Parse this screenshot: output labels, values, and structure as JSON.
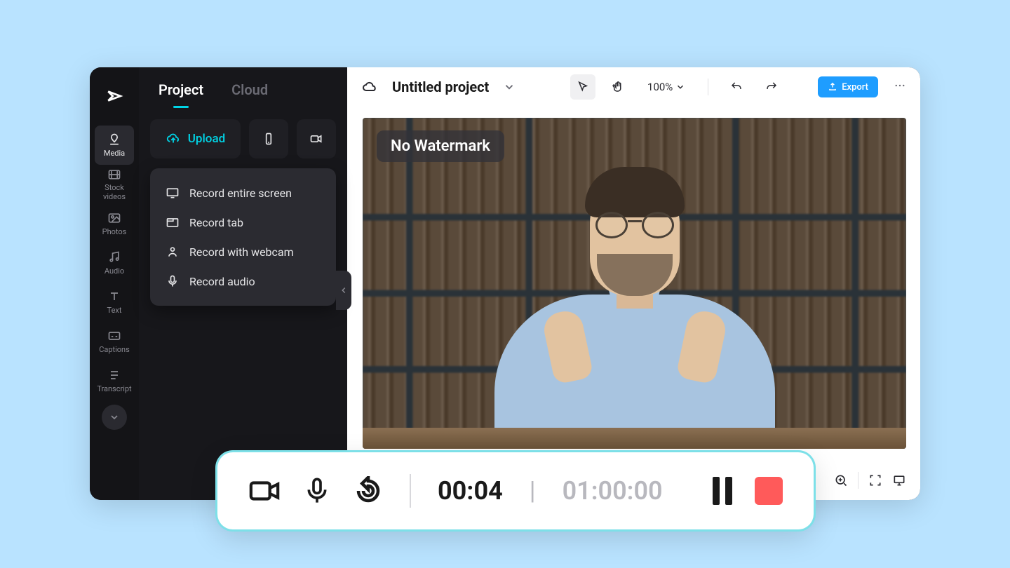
{
  "sidebar": {
    "items": [
      {
        "label": "Media"
      },
      {
        "label": "Stock videos"
      },
      {
        "label": "Photos"
      },
      {
        "label": "Audio"
      },
      {
        "label": "Text"
      },
      {
        "label": "Captions"
      },
      {
        "label": "Transcript"
      }
    ]
  },
  "panel": {
    "tabs": [
      {
        "label": "Project",
        "active": true
      },
      {
        "label": "Cloud",
        "active": false
      }
    ],
    "upload_label": "Upload",
    "record_menu": [
      {
        "label": "Record entire screen",
        "icon": "monitor"
      },
      {
        "label": "Record tab",
        "icon": "tab"
      },
      {
        "label": "Record with webcam",
        "icon": "person"
      },
      {
        "label": "Record audio",
        "icon": "mic"
      }
    ]
  },
  "topbar": {
    "project_title": "Untitled project",
    "zoom": "100%",
    "export_label": "Export"
  },
  "watermark_badge": "No Watermark",
  "recbar": {
    "elapsed": "00:04",
    "duration": "01:00:00"
  }
}
